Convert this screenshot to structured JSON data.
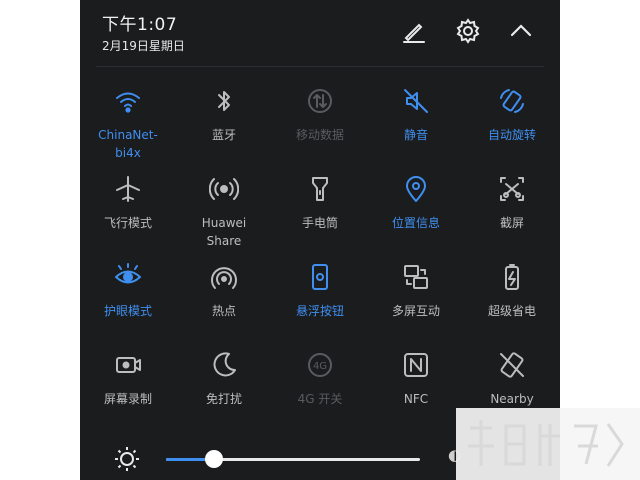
{
  "status": {
    "time": "下午1:07",
    "date": "2月19日星期日"
  },
  "header_icons": [
    "edit-icon",
    "settings-icon",
    "collapse-icon"
  ],
  "colors": {
    "accent": "#3f8ff0",
    "panel": "#1b1c1e",
    "inactive": "#bdbdbd",
    "disabled": "#5a5b5e"
  },
  "toggles": [
    {
      "label": "ChinaNet-\nbi4x",
      "icon": "wifi-icon",
      "state": "on"
    },
    {
      "label": "蓝牙",
      "icon": "bluetooth-icon",
      "state": "off"
    },
    {
      "label": "移动数据",
      "icon": "mobile-data-icon",
      "state": "disabled"
    },
    {
      "label": "静音",
      "icon": "mute-icon",
      "state": "on"
    },
    {
      "label": "自动旋转",
      "icon": "auto-rotate-icon",
      "state": "on"
    },
    {
      "label": "飞行模式",
      "icon": "airplane-icon",
      "state": "off"
    },
    {
      "label": "Huawei\nShare",
      "icon": "huawei-share-icon",
      "state": "off"
    },
    {
      "label": "手电筒",
      "icon": "flashlight-icon",
      "state": "off"
    },
    {
      "label": "位置信息",
      "icon": "location-icon",
      "state": "on"
    },
    {
      "label": "截屏",
      "icon": "screenshot-icon",
      "state": "off"
    },
    {
      "label": "护眼模式",
      "icon": "eye-comfort-icon",
      "state": "on"
    },
    {
      "label": "热点",
      "icon": "hotspot-icon",
      "state": "off"
    },
    {
      "label": "悬浮按钮",
      "icon": "floating-button-icon",
      "state": "on"
    },
    {
      "label": "多屏互动",
      "icon": "multi-screen-icon",
      "state": "off"
    },
    {
      "label": "超级省电",
      "icon": "battery-saver-icon",
      "state": "off"
    },
    {
      "label": "屏幕录制",
      "icon": "screen-record-icon",
      "state": "off"
    },
    {
      "label": "免打扰",
      "icon": "do-not-disturb-icon",
      "state": "off"
    },
    {
      "label": "4G 开关",
      "icon": "4g-icon",
      "state": "disabled"
    },
    {
      "label": "NFC",
      "icon": "nfc-icon",
      "state": "off"
    },
    {
      "label": "Nearby",
      "icon": "nearby-icon",
      "state": "off"
    }
  ],
  "brightness": {
    "level": 0.19,
    "icon": "brightness-icon"
  }
}
